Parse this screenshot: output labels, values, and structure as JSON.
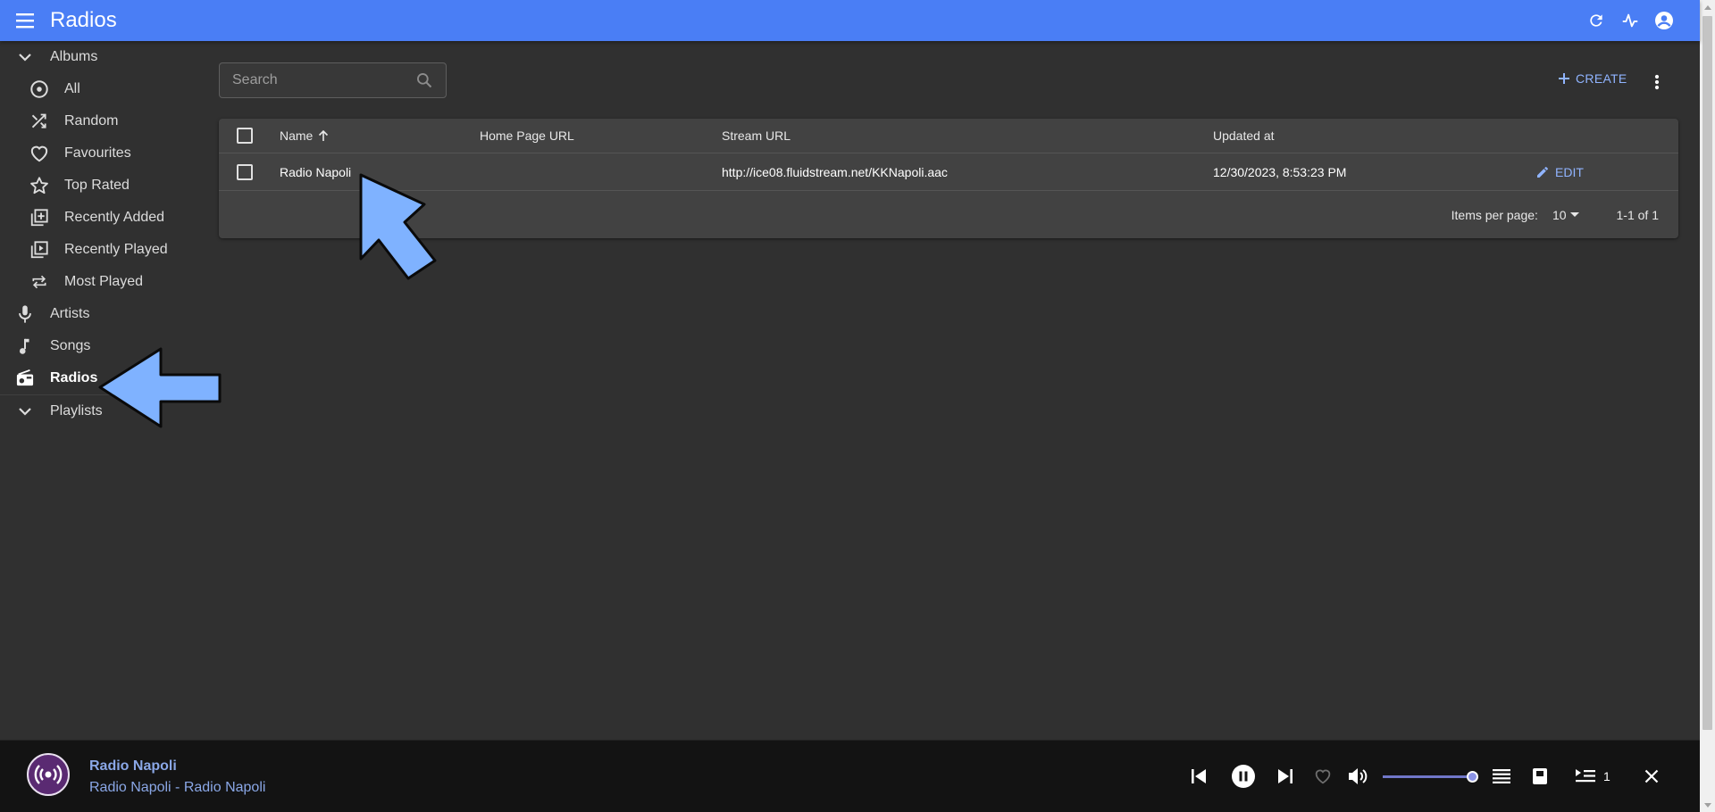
{
  "app": {
    "title": "Radios",
    "accent": "#4a7ef5"
  },
  "sidebar": {
    "sections": [
      {
        "label": "Albums",
        "icon": "chevron-down-icon"
      },
      {
        "label": "Playlists",
        "icon": "chevron-down-icon"
      }
    ],
    "album_items": [
      {
        "label": "All",
        "icon": "album-icon"
      },
      {
        "label": "Random",
        "icon": "shuffle-icon"
      },
      {
        "label": "Favourites",
        "icon": "heart-icon"
      },
      {
        "label": "Top Rated",
        "icon": "star-icon"
      },
      {
        "label": "Recently Added",
        "icon": "library-add-icon"
      },
      {
        "label": "Recently Played",
        "icon": "video-library-icon"
      },
      {
        "label": "Most Played",
        "icon": "repeat-icon"
      }
    ],
    "items": [
      {
        "label": "Artists",
        "icon": "mic-icon"
      },
      {
        "label": "Songs",
        "icon": "music-note-icon"
      },
      {
        "label": "Radios",
        "icon": "radio-icon",
        "active": true
      }
    ]
  },
  "toolbar": {
    "search_placeholder": "Search",
    "create_label": "CREATE"
  },
  "table": {
    "columns": [
      "Name",
      "Home Page URL",
      "Stream URL",
      "Updated at"
    ],
    "sort_column": "Name",
    "sort_direction": "asc",
    "rows": [
      {
        "name": "Radio Napoli",
        "home_page_url": "",
        "stream_url": "http://ice08.fluidstream.net/KKNapoli.aac",
        "updated_at": "12/30/2023, 8:53:23 PM",
        "action": "EDIT"
      }
    ],
    "footer": {
      "items_per_page_label": "Items per page:",
      "items_per_page": "10",
      "range": "1-1 of 1"
    }
  },
  "player": {
    "title": "Radio Napoli",
    "subtitle": "Radio Napoli - Radio Napoli",
    "volume": 1.0,
    "queue_count": "1",
    "accent": "#8aa7e6"
  },
  "colors": {
    "background": "#303030",
    "sidebar_text": "#dcdcdc",
    "link": "#90b4ff",
    "annotation_arrow": "#7fb2ff"
  }
}
